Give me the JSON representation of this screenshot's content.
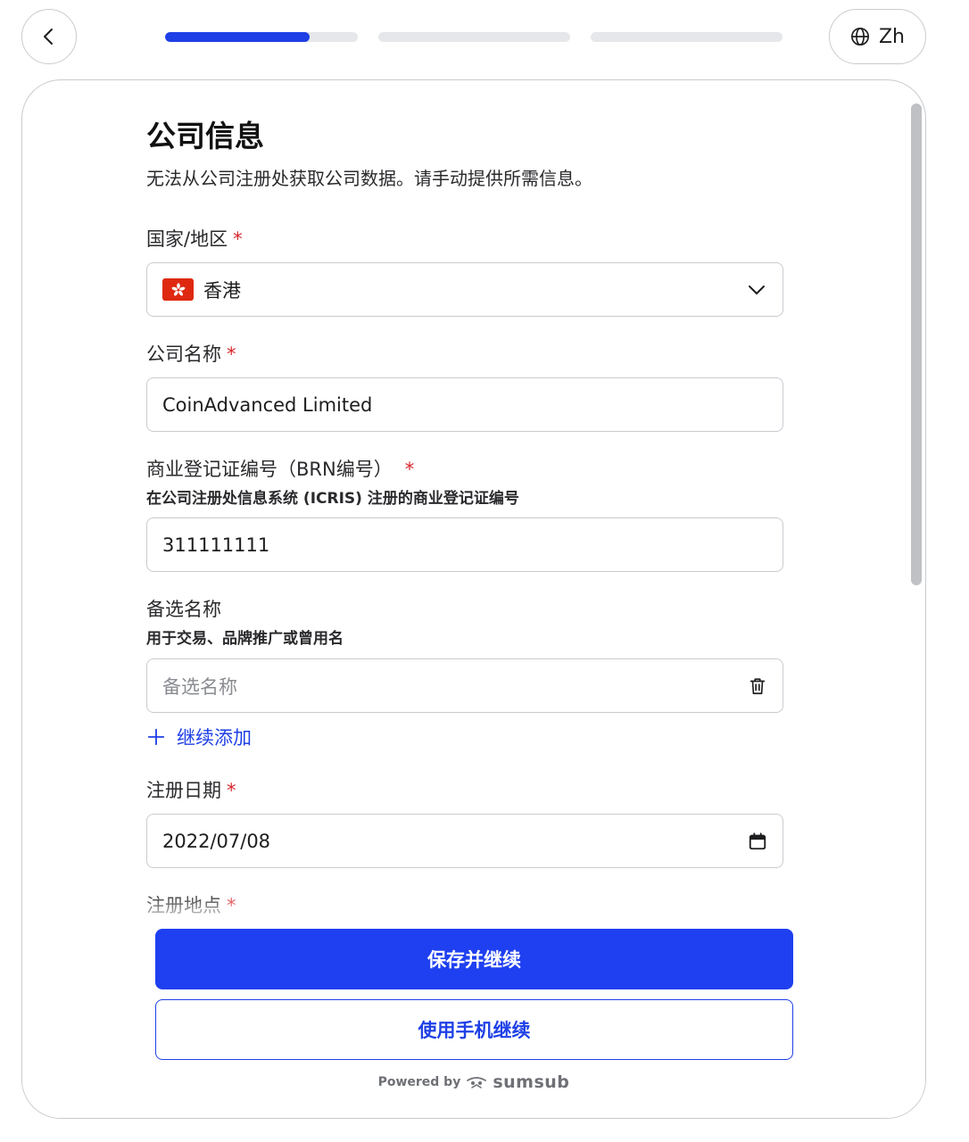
{
  "header": {
    "progress": [
      0.75,
      0,
      0
    ],
    "language_label": "Zh"
  },
  "form": {
    "title": "公司信息",
    "subtitle": "无法从公司注册处获取公司数据。请手动提供所需信息。",
    "country": {
      "label": "国家/地区",
      "required_mark": "*",
      "value": "香港"
    },
    "company_name": {
      "label": "公司名称",
      "required_mark": "*",
      "value": "CoinAdvanced Limited"
    },
    "brn": {
      "label": "商业登记证编号（BRN编号）",
      "required_mark": "*",
      "hint": "在公司注册处信息系统 (ICRIS) 注册的商业登记证编号",
      "value": "311111111"
    },
    "alt_name": {
      "label": "备选名称",
      "hint": "用于交易、品牌推广或曾用名",
      "placeholder": "备选名称",
      "add_more": "继续添加"
    },
    "reg_date": {
      "label": "注册日期",
      "required_mark": "*",
      "value": "2022/07/08"
    },
    "reg_place": {
      "label": "注册地点",
      "required_mark": "*"
    }
  },
  "actions": {
    "primary": "保存并继续",
    "secondary": "使用手机继续"
  },
  "footer": {
    "powered_by": "Powered by",
    "brand": "sumsub"
  },
  "colors": {
    "accent": "#1f40f0",
    "required": "#d7262b"
  }
}
